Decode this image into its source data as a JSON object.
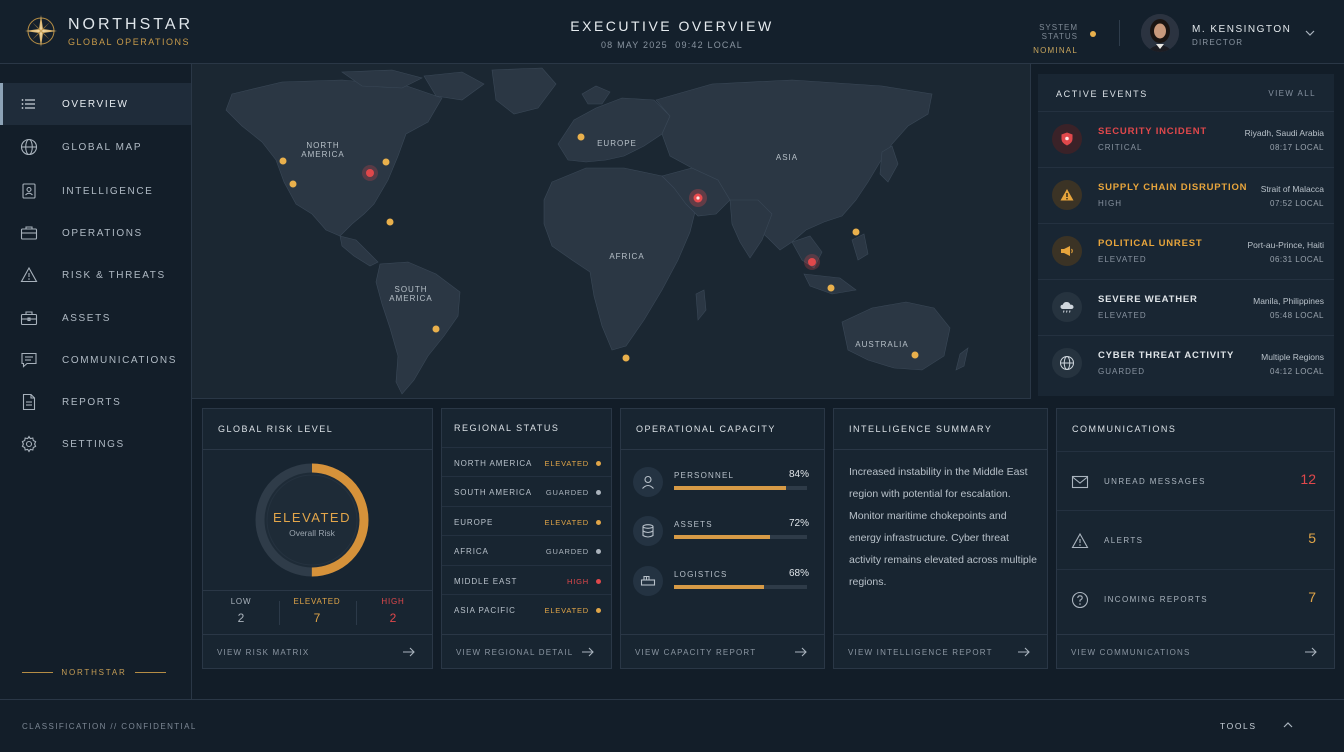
{
  "header": {
    "brand_name": "NORTHSTAR",
    "brand_sub": "GLOBAL OPERATIONS",
    "title": "EXECUTIVE OVERVIEW",
    "date": "08 MAY 2025",
    "time": "09:42  LOCAL",
    "system_status_label": "SYSTEM STATUS",
    "system_status_value": "NOMINAL",
    "user_name": "M. KENSINGTON",
    "user_role": "DIRECTOR"
  },
  "sidebar": {
    "items": [
      {
        "label": "OVERVIEW",
        "icon": "list-icon"
      },
      {
        "label": "GLOBAL MAP",
        "icon": "globe-icon"
      },
      {
        "label": "INTELLIGENCE",
        "icon": "id-card-icon"
      },
      {
        "label": "OPERATIONS",
        "icon": "briefcase-icon"
      },
      {
        "label": "RISK & THREATS",
        "icon": "warning-icon"
      },
      {
        "label": "ASSETS",
        "icon": "toolbox-icon"
      },
      {
        "label": "COMMUNICATIONS",
        "icon": "chat-icon"
      },
      {
        "label": "REPORTS",
        "icon": "document-icon"
      },
      {
        "label": "SETTINGS",
        "icon": "gear-icon"
      }
    ],
    "footer_brand": "NORTHSTAR"
  },
  "map": {
    "labels": {
      "north_america": "NORTH AMERICA",
      "europe": "EUROPE",
      "asia": "ASIA",
      "africa": "AFRICA",
      "south_america": "SOUTH AMERICA",
      "australia": "AUSTRALIA"
    }
  },
  "events": {
    "title": "ACTIVE EVENTS",
    "view_all": "VIEW ALL",
    "items": [
      {
        "name": "SECURITY INCIDENT",
        "level": "CRITICAL",
        "location": "Riyadh, Saudi Arabia",
        "time": "08:17 LOCAL",
        "color": "#e0484b",
        "icon": "shield-icon"
      },
      {
        "name": "SUPPLY CHAIN DISRUPTION",
        "level": "HIGH",
        "location": "Strait of Malacca",
        "time": "07:52 LOCAL",
        "color": "#e8a53c",
        "icon": "warning-icon"
      },
      {
        "name": "POLITICAL UNREST",
        "level": "ELEVATED",
        "location": "Port-au-Prince, Haiti",
        "time": "06:31 LOCAL",
        "color": "#e8a53c",
        "icon": "megaphone-icon"
      },
      {
        "name": "SEVERE WEATHER",
        "level": "ELEVATED",
        "location": "Manila, Philippines",
        "time": "05:48 LOCAL",
        "color": "#dfe4e8",
        "icon": "storm-cloud-icon"
      },
      {
        "name": "CYBER THREAT ACTIVITY",
        "level": "GUARDED",
        "location": "Multiple Regions",
        "time": "04:12 LOCAL",
        "color": "#dfe4e8",
        "icon": "globe-icon"
      }
    ]
  },
  "risk": {
    "title": "GLOBAL RISK LEVEL",
    "level": "ELEVATED",
    "sub": "Overall Risk",
    "gauge_fraction": 0.5,
    "counts": [
      {
        "label": "LOW",
        "value": "2",
        "color": "#aab3bc"
      },
      {
        "label": "ELEVATED",
        "value": "7",
        "color": "#e0a548"
      },
      {
        "label": "HIGH",
        "value": "2",
        "color": "#e0484b"
      }
    ],
    "footer": "VIEW RISK MATRIX"
  },
  "regional": {
    "title": "REGIONAL STATUS",
    "rows": [
      {
        "region": "NORTH AMERICA",
        "status": "ELEVATED",
        "color": "#e0a548"
      },
      {
        "region": "SOUTH AMERICA",
        "status": "GUARDED",
        "color": "#aab3bc"
      },
      {
        "region": "EUROPE",
        "status": "ELEVATED",
        "color": "#e0a548"
      },
      {
        "region": "AFRICA",
        "status": "GUARDED",
        "color": "#aab3bc"
      },
      {
        "region": "MIDDLE EAST",
        "status": "HIGH",
        "color": "#e0484b"
      },
      {
        "region": "ASIA PACIFIC",
        "status": "ELEVATED",
        "color": "#e0a548"
      }
    ],
    "footer": "VIEW REGIONAL DETAIL"
  },
  "capacity": {
    "title": "OPERATIONAL CAPACITY",
    "rows": [
      {
        "name": "PERSONNEL",
        "pct": "84%",
        "value": 0.84,
        "icon": "person-icon"
      },
      {
        "name": "ASSETS",
        "pct": "72%",
        "value": 0.72,
        "icon": "database-icon"
      },
      {
        "name": "LOGISTICS",
        "pct": "68%",
        "value": 0.68,
        "icon": "truck-icon"
      }
    ],
    "footer": "VIEW CAPACITY REPORT"
  },
  "intelligence": {
    "title": "INTELLIGENCE SUMMARY",
    "text": "Increased instability in the Middle East region with potential for escalation. Monitor maritime chokepoints and energy infrastructure. Cyber threat activity remains elevated across multiple regions.",
    "footer": "VIEW INTELLIGENCE REPORT"
  },
  "communications": {
    "title": "COMMUNICATIONS",
    "rows": [
      {
        "label": "UNREAD MESSAGES",
        "value": "12",
        "color": "#e0484b",
        "icon": "envelope-icon"
      },
      {
        "label": "ALERTS",
        "value": "5",
        "color": "#e0a548",
        "icon": "warning-icon"
      },
      {
        "label": "INCOMING REPORTS",
        "value": "7",
        "color": "#e0a548",
        "icon": "question-icon"
      }
    ],
    "footer": "VIEW COMMUNICATIONS"
  },
  "footer": {
    "classification": "CLASSIFICATION  //  CONFIDENTIAL",
    "tools": "TOOLS"
  }
}
